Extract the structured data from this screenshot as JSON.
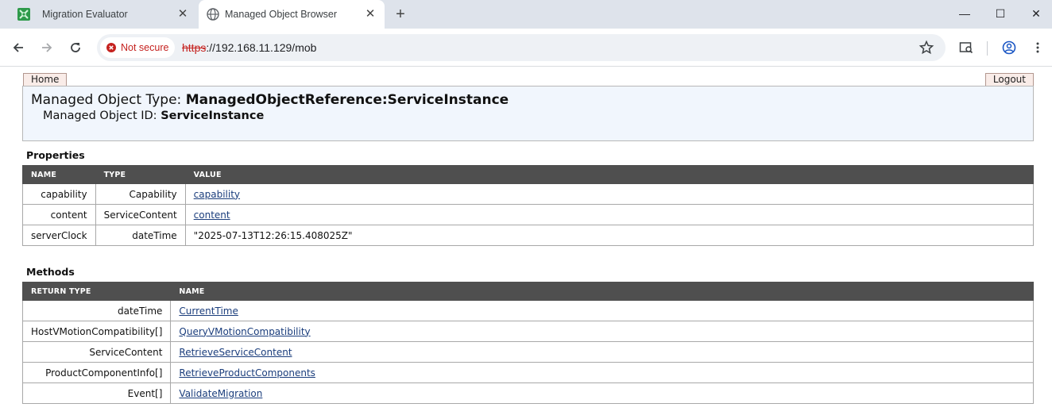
{
  "browser": {
    "tabs": [
      {
        "title": "Migration Evaluator",
        "active": false
      },
      {
        "title": "Managed Object Browser",
        "active": true
      }
    ],
    "security_label": "Not secure",
    "url_scheme": "https",
    "url_rest": "://192.168.11.129/mob",
    "colors": {
      "tabstrip": "#dee3eb",
      "omnibox": "#eef1f5",
      "warning": "#c5221f"
    }
  },
  "page": {
    "home_label": "Home",
    "logout_label": "Logout",
    "mo_type_label": "Managed Object Type:",
    "mo_type_value": "ManagedObjectReference:ServiceInstance",
    "mo_id_label": "Managed Object ID:",
    "mo_id_value": "ServiceInstance",
    "properties": {
      "title": "Properties",
      "headers": [
        "NAME",
        "TYPE",
        "VALUE"
      ],
      "rows": [
        {
          "name": "capability",
          "type": "Capability",
          "value": "capability",
          "link": true
        },
        {
          "name": "content",
          "type": "ServiceContent",
          "value": "content",
          "link": true
        },
        {
          "name": "serverClock",
          "type": "dateTime",
          "value": "\"2025-07-13T12:26:15.408025Z\"",
          "link": false
        }
      ]
    },
    "methods": {
      "title": "Methods",
      "headers": [
        "RETURN TYPE",
        "NAME"
      ],
      "rows": [
        {
          "return_type": "dateTime",
          "name": "CurrentTime"
        },
        {
          "return_type": "HostVMotionCompatibility[]",
          "name": "QueryVMotionCompatibility"
        },
        {
          "return_type": "ServiceContent",
          "name": "RetrieveServiceContent"
        },
        {
          "return_type": "ProductComponentInfo[]",
          "name": "RetrieveProductComponents"
        },
        {
          "return_type": "Event[]",
          "name": "ValidateMigration"
        }
      ]
    },
    "colors": {
      "header_bg": "#4f4f4f",
      "mo_box_bg": "#f1f6fd",
      "link": "#1a3d7c"
    }
  }
}
